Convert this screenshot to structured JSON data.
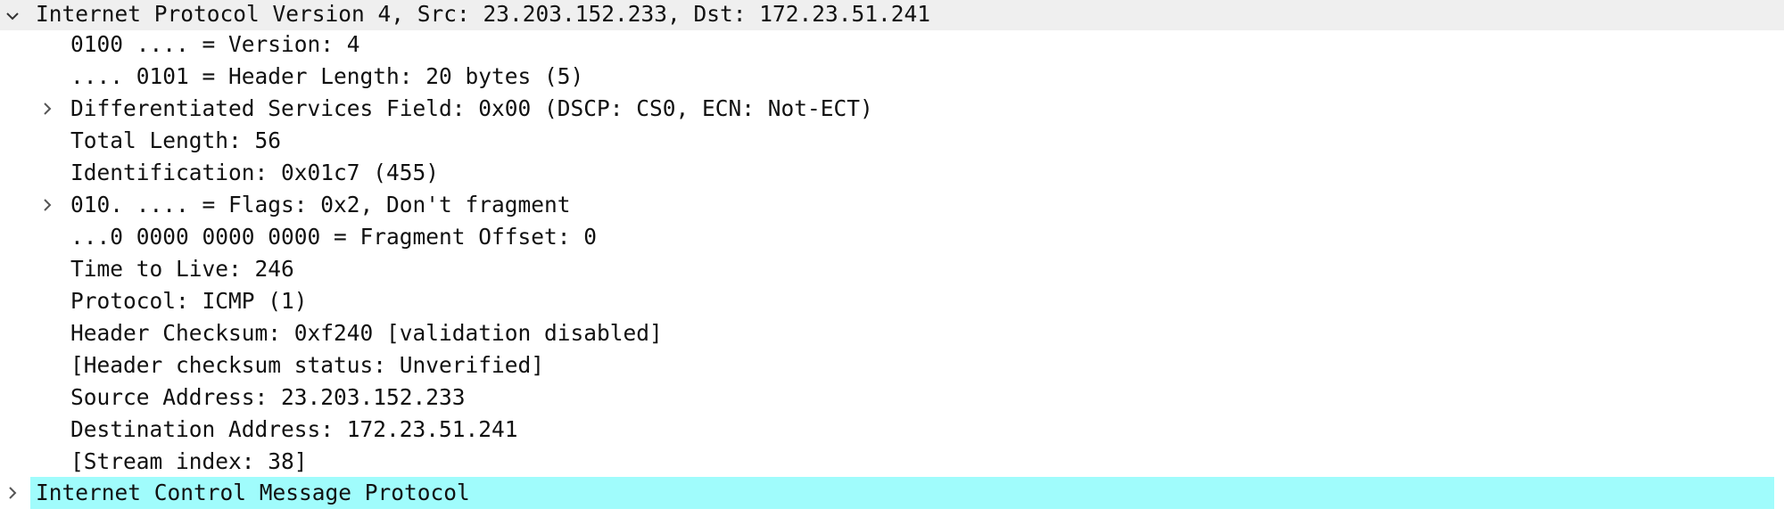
{
  "colors": {
    "highlight_row": "#a0fcfc",
    "header_row": "#efefef"
  },
  "icons": {
    "expanded": "chevron-down-icon",
    "collapsed": "chevron-right-icon"
  },
  "ipv4": {
    "header": "Internet Protocol Version 4, Src: 23.203.152.233, Dst: 172.23.51.241",
    "fields": [
      "0100 .... = Version: 4",
      ".... 0101 = Header Length: 20 bytes (5)",
      "Differentiated Services Field: 0x00 (DSCP: CS0, ECN: Not-ECT)",
      "Total Length: 56",
      "Identification: 0x01c7 (455)",
      "010. .... = Flags: 0x2, Don't fragment",
      "...0 0000 0000 0000 = Fragment Offset: 0",
      "Time to Live: 246",
      "Protocol: ICMP (1)",
      "Header Checksum: 0xf240 [validation disabled]",
      "[Header checksum status: Unverified]",
      "Source Address: 23.203.152.233",
      "Destination Address: 172.23.51.241",
      "[Stream index: 38]"
    ]
  },
  "icmp": {
    "header": "Internet Control Message Protocol"
  }
}
